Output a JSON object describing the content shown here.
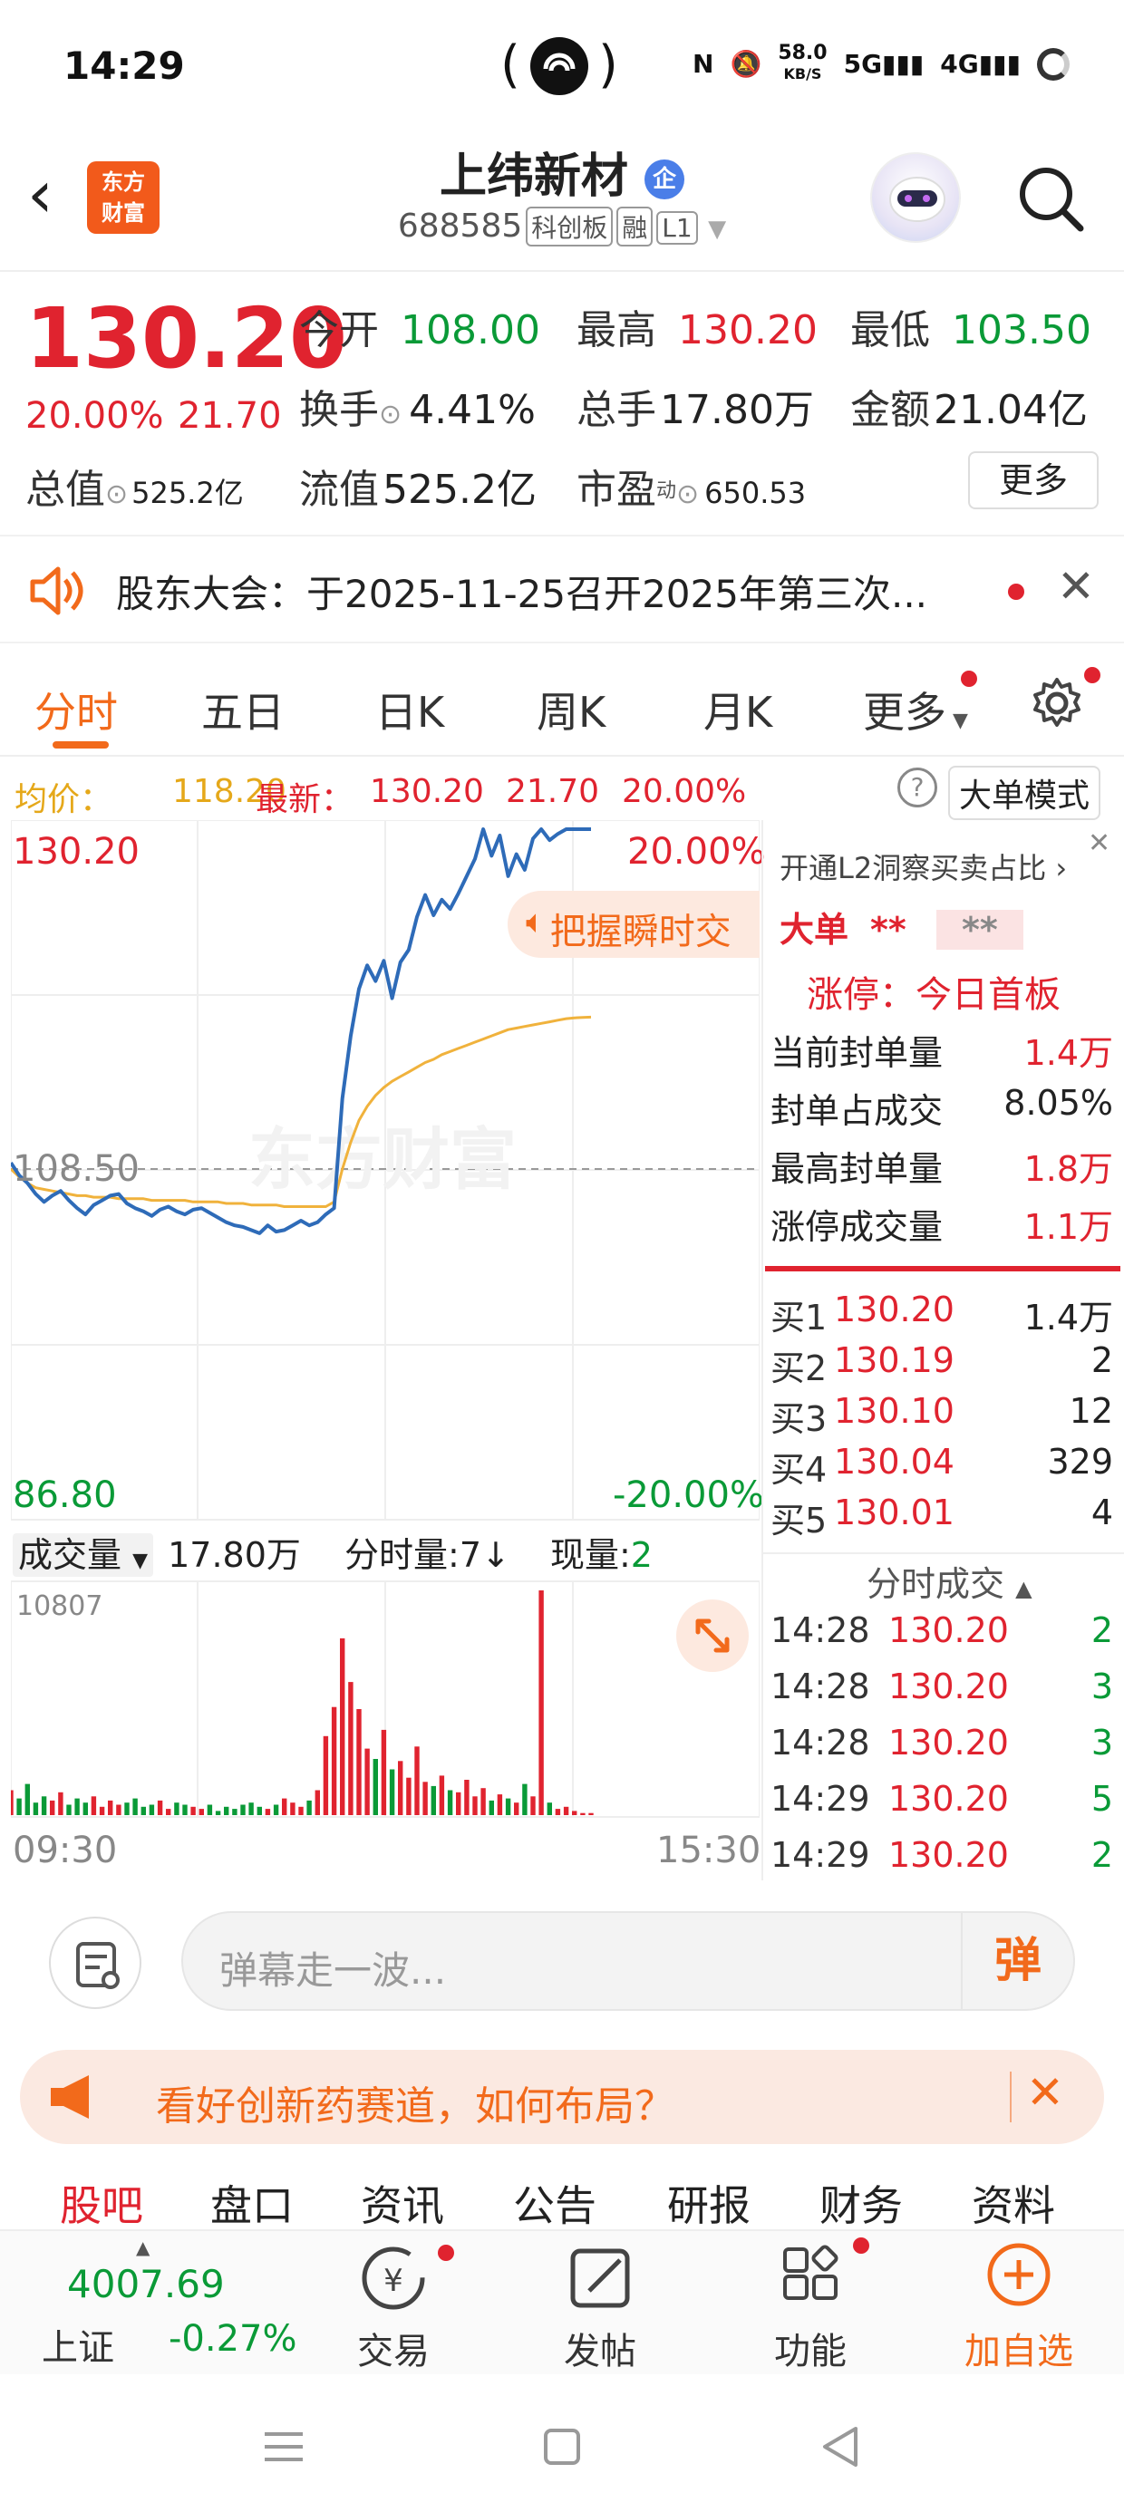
{
  "status_bar": {
    "time": "14:29",
    "net_speed": "58.0",
    "net_unit": "KB/S",
    "icons": [
      "nfc-icon",
      "mute-icon",
      "signal-5g-icon",
      "signal-4g-icon",
      "battery-icon"
    ]
  },
  "header": {
    "back_icon": "back-arrow-icon",
    "logo_line1": "东方",
    "logo_line2": "财富",
    "stock_name": "上纬新材",
    "enterprise_badge": "企",
    "stock_code": "688585",
    "tags": [
      "科创板",
      "融",
      "L1"
    ]
  },
  "quote": {
    "price": "130.20",
    "change_pct": "20.00%",
    "change_amt": "21.70",
    "open_label": "今开",
    "open": "108.00",
    "high_label": "最高",
    "high": "130.20",
    "low_label": "最低",
    "low": "103.50",
    "turnover_label": "换手",
    "turnover": "4.41%",
    "volume_label": "总手",
    "volume": "17.80万",
    "amount_label": "金额",
    "amount": "21.04亿",
    "mktcap_label": "总值",
    "mktcap": "525.2亿",
    "float_label": "流值",
    "float": "525.2亿",
    "pe_label": "市盈",
    "pe_sup": "动",
    "pe": "650.53",
    "more": "更多"
  },
  "notice": {
    "text": "股东大会：于2025-11-25召开2025年第三次..."
  },
  "tabs": [
    "分时",
    "五日",
    "日K",
    "周K",
    "月K",
    "更多"
  ],
  "avg_line": {
    "avg_label": "均价：",
    "avg": "118.20",
    "latest_label": "最新：",
    "latest": "130.20",
    "chg": "21.70",
    "pct": "20.00%",
    "big_order_mode": "大单模式"
  },
  "chart_data": {
    "type": "line",
    "y_top_label": "130.20",
    "y_top_pct": "20.00%",
    "y_mid_label": "108.50",
    "y_bottom_label": "86.80",
    "y_bottom_pct": "-20.00%",
    "ylim": [
      86.8,
      130.2
    ],
    "x_start": "09:30",
    "x_end": "15:30",
    "watermark": "东方财富",
    "popup": "把握瞬时交",
    "price_series": [
      108.9,
      108.1,
      107.6,
      106.9,
      106.4,
      106.8,
      107.1,
      106.5,
      106.0,
      105.6,
      106.2,
      106.5,
      106.8,
      106.9,
      106.3,
      106.0,
      105.8,
      105.5,
      105.9,
      106.1,
      105.8,
      105.6,
      105.9,
      106.0,
      105.7,
      105.4,
      105.1,
      104.9,
      104.8,
      104.6,
      104.4,
      104.9,
      104.5,
      104.6,
      104.9,
      105.2,
      104.9,
      105.1,
      105.6,
      106.0,
      113.0,
      117.0,
      120.0,
      121.5,
      120.5,
      121.8,
      119.4,
      121.7,
      122.5,
      124.6,
      126.0,
      124.7,
      125.7,
      125.1,
      126.1,
      127.2,
      128.3,
      130.2,
      128.5,
      129.8,
      127.2,
      128.6,
      127.6,
      129.6,
      130.2,
      129.5,
      129.9,
      130.2,
      130.2,
      130.2,
      130.2
    ],
    "avg_series": [
      108.5,
      108.0,
      107.6,
      107.3,
      107.2,
      107.1,
      107.0,
      106.9,
      106.8,
      106.8,
      106.7,
      106.7,
      106.7,
      106.6,
      106.6,
      106.6,
      106.6,
      106.5,
      106.5,
      106.5,
      106.5,
      106.5,
      106.4,
      106.4,
      106.4,
      106.4,
      106.3,
      106.3,
      106.3,
      106.2,
      106.2,
      106.2,
      106.2,
      106.1,
      106.1,
      106.1,
      106.1,
      106.1,
      106.1,
      106.4,
      108.5,
      110.2,
      111.6,
      112.5,
      113.2,
      113.7,
      114.1,
      114.4,
      114.7,
      115.0,
      115.3,
      115.5,
      115.8,
      116.0,
      116.2,
      116.4,
      116.6,
      116.8,
      117.0,
      117.2,
      117.4,
      117.5,
      117.6,
      117.7,
      117.8,
      117.9,
      118.0,
      118.1,
      118.15,
      118.18,
      118.2
    ],
    "volume_header": {
      "label": "成交量",
      "total": "17.80万",
      "tick_label": "分时量:",
      "tick": "7↓",
      "now_label": "现量:",
      "now": "2"
    },
    "volume_max_label": "10807",
    "volume_series": [
      1200,
      800,
      1500,
      600,
      900,
      700,
      1100,
      500,
      800,
      600,
      900,
      400,
      700,
      500,
      600,
      800,
      400,
      500,
      700,
      300,
      600,
      500,
      400,
      300,
      500,
      200,
      400,
      300,
      500,
      600,
      400,
      300,
      500,
      800,
      600,
      400,
      700,
      1200,
      3800,
      5200,
      8500,
      6400,
      5100,
      3200,
      2700,
      4100,
      2200,
      2600,
      1800,
      3300,
      1600,
      1400,
      1900,
      1200,
      1100,
      1700,
      900,
      1300,
      700,
      1000,
      800,
      600,
      1500,
      900,
      10807,
      600,
      300,
      400,
      200,
      100,
      100
    ]
  },
  "right_panel": {
    "l2_link": "开通L2洞察买卖占比",
    "big_order_label": "大单",
    "big_order_a": "**",
    "big_order_b": "**",
    "limit_title": "涨停：今日首板",
    "stats": [
      {
        "label": "当前封单量",
        "value": "1.4万"
      },
      {
        "label": "封单占成交",
        "value": "8.05%"
      },
      {
        "label": "最高封单量",
        "value": "1.8万"
      },
      {
        "label": "涨停成交量",
        "value": "1.1万"
      }
    ],
    "bids": [
      {
        "label": "买1",
        "price": "130.20",
        "vol": "1.4万"
      },
      {
        "label": "买2",
        "price": "130.19",
        "vol": "2"
      },
      {
        "label": "买3",
        "price": "130.10",
        "vol": "12"
      },
      {
        "label": "买4",
        "price": "130.04",
        "vol": "329"
      },
      {
        "label": "买5",
        "price": "130.01",
        "vol": "4"
      }
    ],
    "ticks_title": "分时成交",
    "ticks": [
      {
        "time": "14:28",
        "price": "130.20",
        "vol": "2"
      },
      {
        "time": "14:28",
        "price": "130.20",
        "vol": "3"
      },
      {
        "time": "14:28",
        "price": "130.20",
        "vol": "3"
      },
      {
        "time": "14:29",
        "price": "130.20",
        "vol": "5"
      },
      {
        "time": "14:29",
        "price": "130.20",
        "vol": "2"
      }
    ]
  },
  "comment": {
    "placeholder": "弹幕走一波...",
    "danmu_button": "弹"
  },
  "promo": {
    "text": "看好创新药赛道，如何布局？"
  },
  "subtabs": [
    "股吧",
    "盘口",
    "资讯",
    "公告",
    "研报",
    "财务",
    "资料"
  ],
  "bottom_bar": {
    "index_value": "4007.69",
    "index_name": "上证",
    "index_change": "-0.27%",
    "items": [
      "交易",
      "发帖",
      "功能",
      "加自选"
    ]
  }
}
